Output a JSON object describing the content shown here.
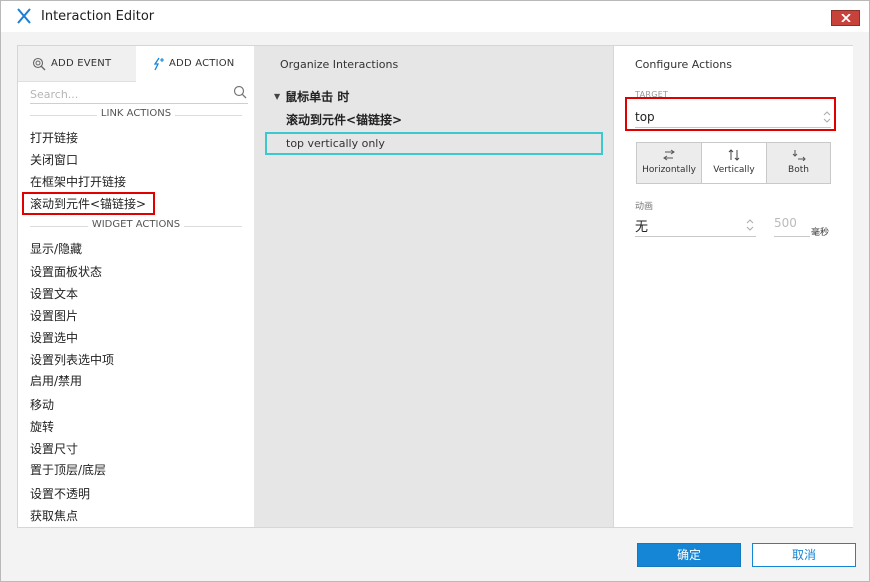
{
  "window": {
    "title": "Interaction Editor"
  },
  "left_panel": {
    "tabs": [
      {
        "label": "ADD EVENT",
        "icon": "add-event-icon"
      },
      {
        "label": "ADD ACTION",
        "icon": "add-action-icon"
      }
    ],
    "search_placeholder": "Search...",
    "link_section": "LINK ACTIONS",
    "link_items": [
      "打开链接",
      "关闭窗口",
      "在框架中打开链接",
      "滚动到元件<锚链接>"
    ],
    "widget_section": "WIDGET ACTIONS",
    "widget_items": [
      "显示/隐藏",
      "设置面板状态",
      "设置文本",
      "设置图片",
      "设置选中",
      "设置列表选中项",
      "启用/禁用",
      "移动",
      "旋转",
      "设置尺寸",
      "置于顶层/底层",
      "设置不透明",
      "获取焦点"
    ]
  },
  "middle_panel": {
    "title": "Organize Interactions",
    "event": "鼠标单击 时",
    "action": "滚动到元件<锚链接>",
    "sub_action": "top vertically only"
  },
  "right_panel": {
    "title": "Configure Actions",
    "target_label": "TARGET",
    "target_value": "top",
    "scroll_options": [
      {
        "label": "Horizontally",
        "selected": false
      },
      {
        "label": "Vertically",
        "selected": true
      },
      {
        "label": "Both",
        "selected": false
      }
    ],
    "animation_label": "动画",
    "animation_value": "无",
    "duration_value": "500",
    "duration_unit": "毫秒"
  },
  "footer": {
    "ok_label": "确定",
    "cancel_label": "取消"
  },
  "colors": {
    "accent": "#1586d6",
    "highlight_red": "#e00000",
    "selection_cyan": "#3cc8d0",
    "close_button": "#c8423c"
  }
}
